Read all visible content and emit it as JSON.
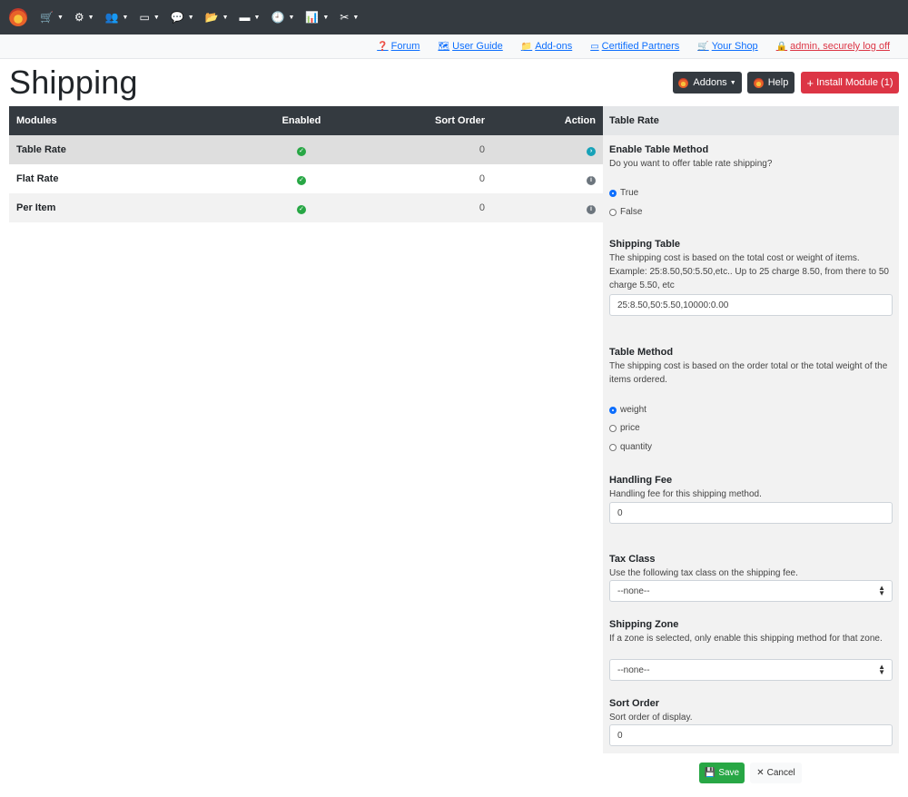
{
  "topnav": {
    "items": [
      {
        "icon": "cart-icon",
        "glyph": "🛒"
      },
      {
        "icon": "cogs-icon",
        "glyph": "⚙"
      },
      {
        "icon": "users-icon",
        "glyph": "👥"
      },
      {
        "icon": "id-card-icon",
        "glyph": "▭"
      },
      {
        "icon": "comments-icon",
        "glyph": "💬"
      },
      {
        "icon": "folder-open-icon",
        "glyph": "📂"
      },
      {
        "icon": "credit-card-icon",
        "glyph": "▬"
      },
      {
        "icon": "clock-icon",
        "glyph": "🕘"
      },
      {
        "icon": "chart-icon",
        "glyph": "📊"
      },
      {
        "icon": "tools-icon",
        "glyph": "✂"
      }
    ],
    "caret": "▼"
  },
  "linkbar": {
    "forum": "Forum",
    "user_guide": "User Guide",
    "addons": "Add-ons",
    "certified_partners": "Certified Partners",
    "your_shop": "Your Shop",
    "logoff": "admin, securely log off"
  },
  "page": {
    "title": "Shipping",
    "addons_button": "Addons",
    "help_button": "Help",
    "install_button": "Install Module (1)"
  },
  "modules_table": {
    "headers": {
      "modules": "Modules",
      "enabled": "Enabled",
      "sort_order": "Sort Order",
      "action": "Action"
    },
    "rows": [
      {
        "name": "Table Rate",
        "enabled": true,
        "sort_order": "0",
        "action": "go"
      },
      {
        "name": "Flat Rate",
        "enabled": true,
        "sort_order": "0",
        "action": "info"
      },
      {
        "name": "Per Item",
        "enabled": true,
        "sort_order": "0",
        "action": "info"
      }
    ]
  },
  "panel": {
    "title": "Table Rate",
    "enable": {
      "title": "Enable Table Method",
      "desc": "Do you want to offer table rate shipping?",
      "options": [
        "True",
        "False"
      ],
      "selected": "True"
    },
    "shipping_table": {
      "title": "Shipping Table",
      "desc": "The shipping cost is based on the total cost or weight of items. Example: 25:8.50,50:5.50,etc.. Up to 25 charge 8.50, from there to 50 charge 5.50, etc",
      "value": "25:8.50,50:5.50,10000:0.00"
    },
    "table_method": {
      "title": "Table Method",
      "desc": "The shipping cost is based on the order total or the total weight of the items ordered.",
      "options": [
        "weight",
        "price",
        "quantity"
      ],
      "selected": "weight"
    },
    "handling_fee": {
      "title": "Handling Fee",
      "desc": "Handling fee for this shipping method.",
      "value": "0"
    },
    "tax_class": {
      "title": "Tax Class",
      "desc": "Use the following tax class on the shipping fee.",
      "value": "--none--"
    },
    "shipping_zone": {
      "title": "Shipping Zone",
      "desc": "If a zone is selected, only enable this shipping method for that zone.",
      "value": "--none--"
    },
    "sort_order": {
      "title": "Sort Order",
      "desc": "Sort order of display.",
      "value": "0"
    }
  },
  "footer": {
    "save": "Save",
    "cancel": "Cancel"
  }
}
